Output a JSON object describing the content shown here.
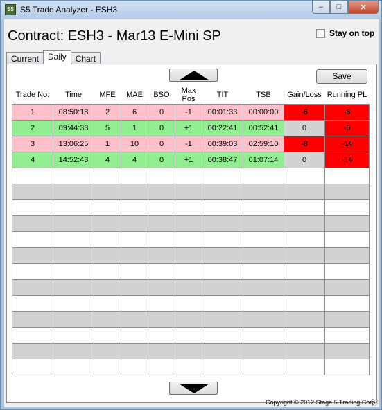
{
  "window": {
    "title": "S5 Trade Analyzer - ESH3",
    "icon_text": "S5",
    "buttons": {
      "minimize": "minimize",
      "maximize": "maximize",
      "close": "close"
    }
  },
  "header": {
    "contract": "Contract: ESH3 - Mar13 E-Mini SP",
    "stay_on_top_label": "Stay on top",
    "stay_on_top_checked": false
  },
  "tabs": [
    {
      "label": "Current",
      "active": false
    },
    {
      "label": "Daily",
      "active": true
    },
    {
      "label": "Chart",
      "active": false
    }
  ],
  "toolbar": {
    "save_label": "Save"
  },
  "table": {
    "columns": [
      "Trade No.",
      "Time",
      "MFE",
      "MAE",
      "BSO",
      "Max\nPos",
      "TIT",
      "TSB",
      "Gain/Loss",
      "Running PL"
    ],
    "rows": [
      {
        "row_color": "pink",
        "cells": [
          "1",
          "08:50:18",
          "2",
          "6",
          "0",
          "-1",
          "00:01:33",
          "00:00:00",
          "-6",
          "-6"
        ],
        "gain_color": "red",
        "pl_color": "red"
      },
      {
        "row_color": "green",
        "cells": [
          "2",
          "09:44:33",
          "5",
          "1",
          "0",
          "+1",
          "00:22:41",
          "00:52:41",
          "0",
          "-6"
        ],
        "gain_color": "gray",
        "pl_color": "red"
      },
      {
        "row_color": "pink",
        "cells": [
          "3",
          "13:06:25",
          "1",
          "10",
          "0",
          "-1",
          "00:39:03",
          "02:59:10",
          "-8",
          "-14"
        ],
        "gain_color": "red",
        "pl_color": "red"
      },
      {
        "row_color": "green",
        "cells": [
          "4",
          "14:52:43",
          "4",
          "4",
          "0",
          "+1",
          "00:38:47",
          "01:07:14",
          "0",
          "-14"
        ],
        "gain_color": "gray",
        "pl_color": "red"
      }
    ],
    "empty_rows": 13
  },
  "colors": {
    "pink": "#ffc0cb",
    "green": "#90ee90",
    "red": "#ff0000",
    "gray": "#d3d3d3"
  },
  "footer": {
    "copyright": "Copyright © 2012 Stage 5 Trading Corp."
  }
}
